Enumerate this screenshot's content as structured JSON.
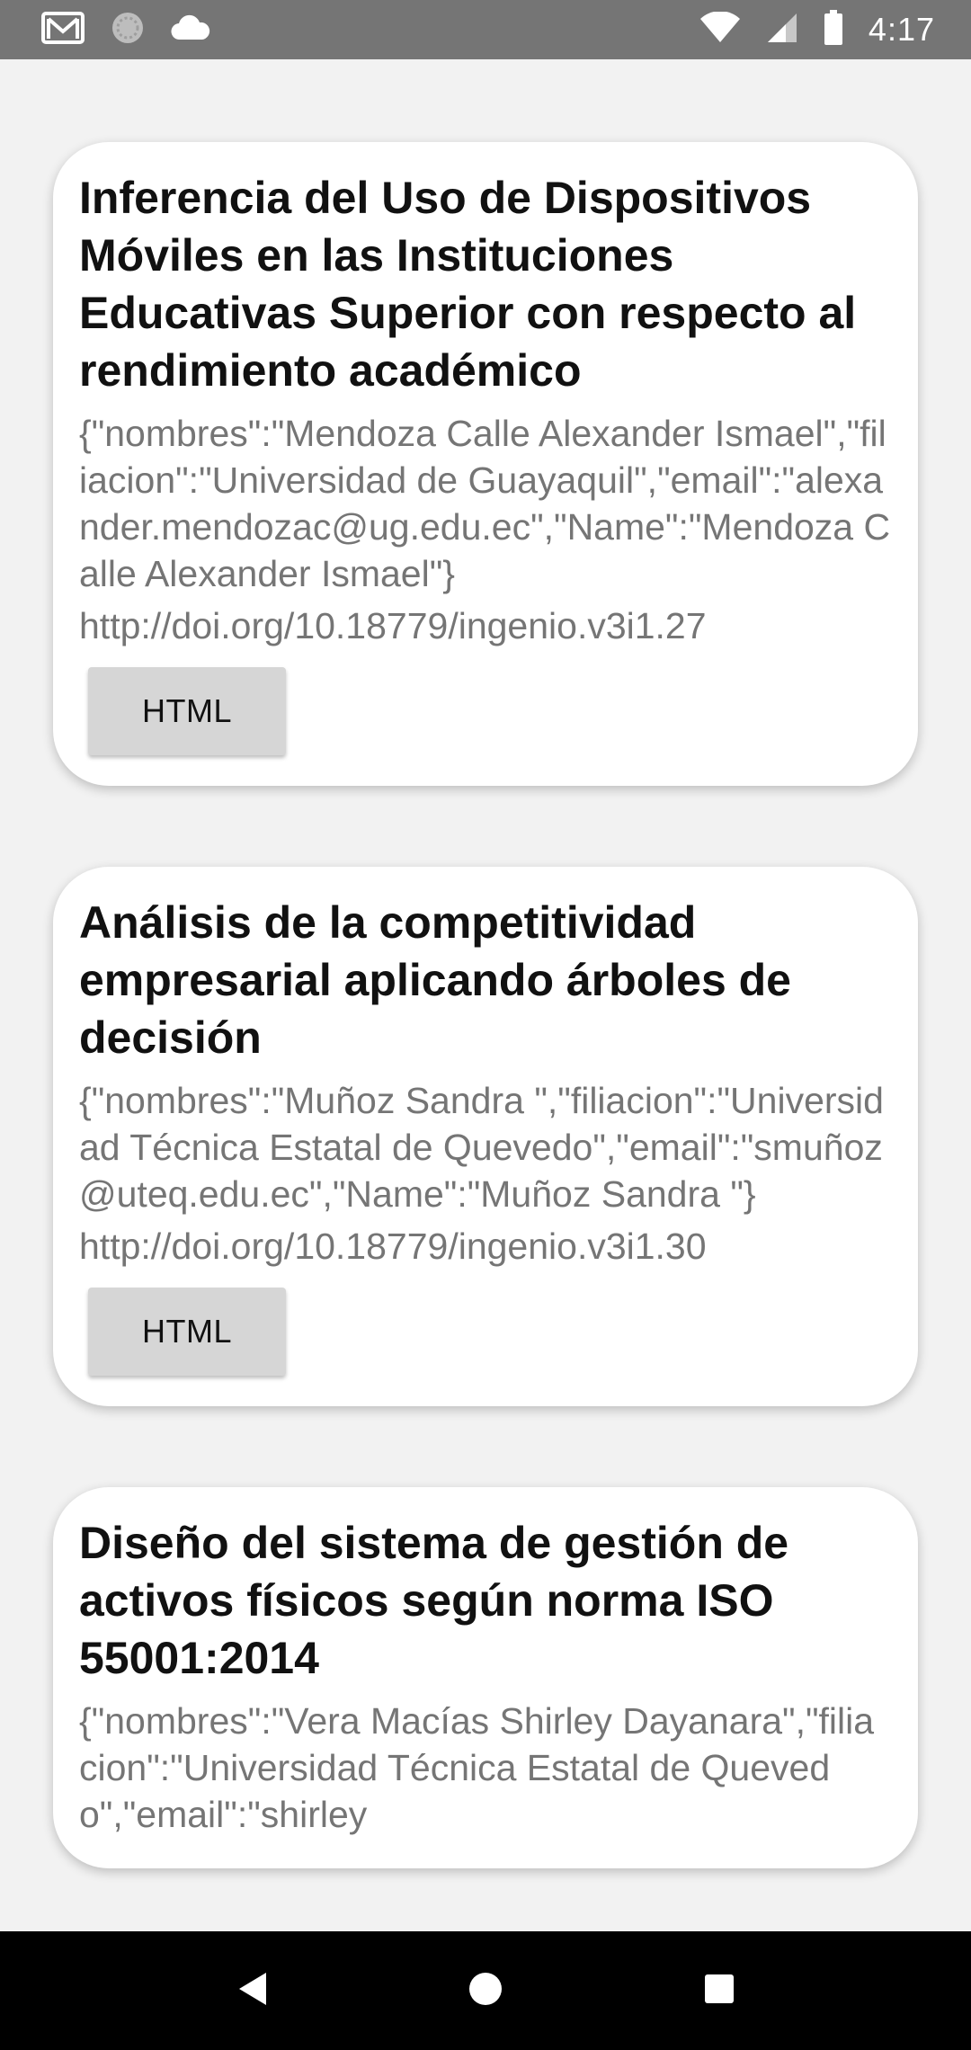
{
  "status_bar": {
    "time": "4:17",
    "icons_left": [
      "gmail-icon",
      "sync-icon",
      "cloud-icon"
    ],
    "icons_right": [
      "wifi-icon",
      "signal-icon",
      "battery-icon"
    ]
  },
  "cards": [
    {
      "title": "Inferencia del Uso de Dispositivos Móviles en las Instituciones Educativas Superior con respecto al rendimiento académico",
      "authors": "{\"nombres\":\"Mendoza Calle Alexander Ismael\",\"filiacion\":\"Universidad de Guayaquil\",\"email\":\"alexander.mendozac@ug.edu.ec\",\"Name\":\"Mendoza Calle Alexander Ismael\"}",
      "doi": "http://doi.org/10.18779/ingenio.v3i1.27",
      "button_label": "HTML"
    },
    {
      "title": "Análisis de la competitividad empresarial aplicando árboles de decisión",
      "authors": "{\"nombres\":\"Muñoz Sandra \",\"filiacion\":\"Universidad Técnica Estatal de Quevedo\",\"email\":\"smuñoz@uteq.edu.ec\",\"Name\":\"Muñoz Sandra \"}",
      "doi": "http://doi.org/10.18779/ingenio.v3i1.30",
      "button_label": "HTML"
    },
    {
      "title": "Diseño del sistema de gestión de activos físicos según norma ISO 55001:2014",
      "authors": "{\"nombres\":\"Vera Macías Shirley Dayanara\",\"filiacion\":\"Universidad Técnica Estatal de Quevedo\",\"email\":\"shirley",
      "doi": "",
      "button_label": ""
    }
  ],
  "nav_bar": {
    "icons": [
      "back-icon",
      "home-icon",
      "recents-icon"
    ]
  }
}
